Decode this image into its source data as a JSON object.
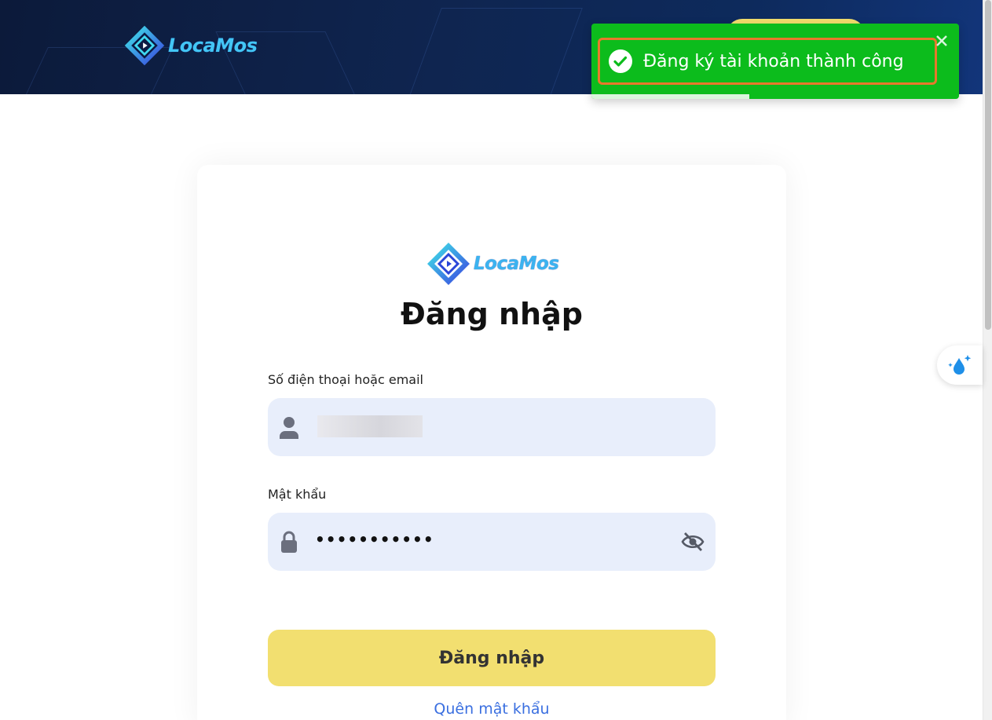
{
  "header": {
    "logo_text": "LocaMos"
  },
  "card": {
    "logo_text": "LocaMos",
    "title": "Đăng nhập",
    "phone_email_label": "Số điện thoại hoặc email",
    "password_label": "Mật khẩu",
    "password_value": "•••••••••••",
    "login_button": "Đăng nhập",
    "forgot_password": "Quên mật khẩu"
  },
  "toast": {
    "message": "Đăng ký tài khoản thành công",
    "progress_fraction": 0.43
  },
  "colors": {
    "accent_yellow": "#f2df70",
    "toast_green": "#0cbc1c",
    "input_bg": "#e8eefb",
    "link_blue": "#3a6fe0"
  },
  "icons": {
    "user": "user-icon",
    "lock": "lock-icon",
    "eye": "eye-off-icon",
    "check": "check-circle-icon",
    "close": "close-icon",
    "water": "water-drop-icon"
  }
}
